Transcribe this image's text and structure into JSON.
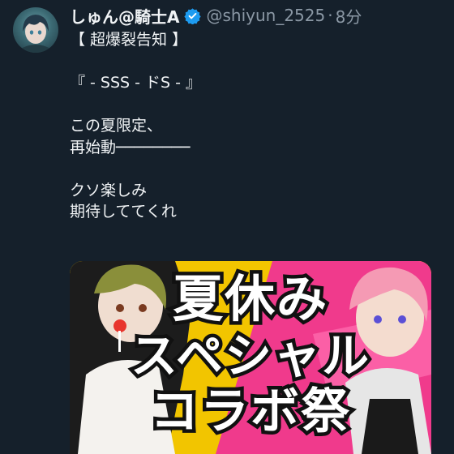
{
  "tweet": {
    "display_name": "しゅん@騎士A",
    "handle": "@shiyun_2525",
    "separator": "·",
    "time": "8分",
    "lines": [
      "【 超爆裂告知 】",
      "",
      "『 - SSS - ドS - 』",
      "",
      "この夏限定、",
      "再始動────────",
      "",
      "クソ楽しみ",
      "期待しててくれ"
    ]
  },
  "media": {
    "banner_line1": "夏休み",
    "banner_line2": "スペシャル",
    "banner_line3": "コラボ祭"
  },
  "colors": {
    "background": "#15202b",
    "verified": "#1d9bf0",
    "banner_bg": "#f2c500",
    "banner_pink": "#f03a8c"
  }
}
